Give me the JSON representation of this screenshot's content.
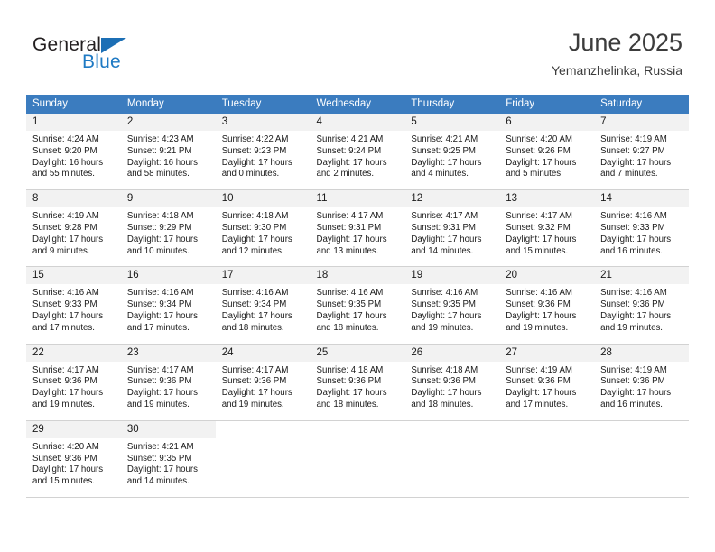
{
  "logo": {
    "word_one": "General",
    "word_two": "Blue",
    "triangle": "blue-triangle",
    "accent_color": "#1c6fb5",
    "text_color": "#231f20"
  },
  "header": {
    "title": "June 2025",
    "subtitle": "Yemanzhelinka, Russia"
  },
  "calendar": {
    "header_color": "#3b7cbf",
    "daynum_bg": "#f2f2f2",
    "weekdays": [
      "Sunday",
      "Monday",
      "Tuesday",
      "Wednesday",
      "Thursday",
      "Friday",
      "Saturday"
    ],
    "weeks": [
      [
        {
          "day": "1",
          "sunrise": "Sunrise: 4:24 AM",
          "sunset": "Sunset: 9:20 PM",
          "daylight_1": "Daylight: 16 hours",
          "daylight_2": "and 55 minutes."
        },
        {
          "day": "2",
          "sunrise": "Sunrise: 4:23 AM",
          "sunset": "Sunset: 9:21 PM",
          "daylight_1": "Daylight: 16 hours",
          "daylight_2": "and 58 minutes."
        },
        {
          "day": "3",
          "sunrise": "Sunrise: 4:22 AM",
          "sunset": "Sunset: 9:23 PM",
          "daylight_1": "Daylight: 17 hours",
          "daylight_2": "and 0 minutes."
        },
        {
          "day": "4",
          "sunrise": "Sunrise: 4:21 AM",
          "sunset": "Sunset: 9:24 PM",
          "daylight_1": "Daylight: 17 hours",
          "daylight_2": "and 2 minutes."
        },
        {
          "day": "5",
          "sunrise": "Sunrise: 4:21 AM",
          "sunset": "Sunset: 9:25 PM",
          "daylight_1": "Daylight: 17 hours",
          "daylight_2": "and 4 minutes."
        },
        {
          "day": "6",
          "sunrise": "Sunrise: 4:20 AM",
          "sunset": "Sunset: 9:26 PM",
          "daylight_1": "Daylight: 17 hours",
          "daylight_2": "and 5 minutes."
        },
        {
          "day": "7",
          "sunrise": "Sunrise: 4:19 AM",
          "sunset": "Sunset: 9:27 PM",
          "daylight_1": "Daylight: 17 hours",
          "daylight_2": "and 7 minutes."
        }
      ],
      [
        {
          "day": "8",
          "sunrise": "Sunrise: 4:19 AM",
          "sunset": "Sunset: 9:28 PM",
          "daylight_1": "Daylight: 17 hours",
          "daylight_2": "and 9 minutes."
        },
        {
          "day": "9",
          "sunrise": "Sunrise: 4:18 AM",
          "sunset": "Sunset: 9:29 PM",
          "daylight_1": "Daylight: 17 hours",
          "daylight_2": "and 10 minutes."
        },
        {
          "day": "10",
          "sunrise": "Sunrise: 4:18 AM",
          "sunset": "Sunset: 9:30 PM",
          "daylight_1": "Daylight: 17 hours",
          "daylight_2": "and 12 minutes."
        },
        {
          "day": "11",
          "sunrise": "Sunrise: 4:17 AM",
          "sunset": "Sunset: 9:31 PM",
          "daylight_1": "Daylight: 17 hours",
          "daylight_2": "and 13 minutes."
        },
        {
          "day": "12",
          "sunrise": "Sunrise: 4:17 AM",
          "sunset": "Sunset: 9:31 PM",
          "daylight_1": "Daylight: 17 hours",
          "daylight_2": "and 14 minutes."
        },
        {
          "day": "13",
          "sunrise": "Sunrise: 4:17 AM",
          "sunset": "Sunset: 9:32 PM",
          "daylight_1": "Daylight: 17 hours",
          "daylight_2": "and 15 minutes."
        },
        {
          "day": "14",
          "sunrise": "Sunrise: 4:16 AM",
          "sunset": "Sunset: 9:33 PM",
          "daylight_1": "Daylight: 17 hours",
          "daylight_2": "and 16 minutes."
        }
      ],
      [
        {
          "day": "15",
          "sunrise": "Sunrise: 4:16 AM",
          "sunset": "Sunset: 9:33 PM",
          "daylight_1": "Daylight: 17 hours",
          "daylight_2": "and 17 minutes."
        },
        {
          "day": "16",
          "sunrise": "Sunrise: 4:16 AM",
          "sunset": "Sunset: 9:34 PM",
          "daylight_1": "Daylight: 17 hours",
          "daylight_2": "and 17 minutes."
        },
        {
          "day": "17",
          "sunrise": "Sunrise: 4:16 AM",
          "sunset": "Sunset: 9:34 PM",
          "daylight_1": "Daylight: 17 hours",
          "daylight_2": "and 18 minutes."
        },
        {
          "day": "18",
          "sunrise": "Sunrise: 4:16 AM",
          "sunset": "Sunset: 9:35 PM",
          "daylight_1": "Daylight: 17 hours",
          "daylight_2": "and 18 minutes."
        },
        {
          "day": "19",
          "sunrise": "Sunrise: 4:16 AM",
          "sunset": "Sunset: 9:35 PM",
          "daylight_1": "Daylight: 17 hours",
          "daylight_2": "and 19 minutes."
        },
        {
          "day": "20",
          "sunrise": "Sunrise: 4:16 AM",
          "sunset": "Sunset: 9:36 PM",
          "daylight_1": "Daylight: 17 hours",
          "daylight_2": "and 19 minutes."
        },
        {
          "day": "21",
          "sunrise": "Sunrise: 4:16 AM",
          "sunset": "Sunset: 9:36 PM",
          "daylight_1": "Daylight: 17 hours",
          "daylight_2": "and 19 minutes."
        }
      ],
      [
        {
          "day": "22",
          "sunrise": "Sunrise: 4:17 AM",
          "sunset": "Sunset: 9:36 PM",
          "daylight_1": "Daylight: 17 hours",
          "daylight_2": "and 19 minutes."
        },
        {
          "day": "23",
          "sunrise": "Sunrise: 4:17 AM",
          "sunset": "Sunset: 9:36 PM",
          "daylight_1": "Daylight: 17 hours",
          "daylight_2": "and 19 minutes."
        },
        {
          "day": "24",
          "sunrise": "Sunrise: 4:17 AM",
          "sunset": "Sunset: 9:36 PM",
          "daylight_1": "Daylight: 17 hours",
          "daylight_2": "and 19 minutes."
        },
        {
          "day": "25",
          "sunrise": "Sunrise: 4:18 AM",
          "sunset": "Sunset: 9:36 PM",
          "daylight_1": "Daylight: 17 hours",
          "daylight_2": "and 18 minutes."
        },
        {
          "day": "26",
          "sunrise": "Sunrise: 4:18 AM",
          "sunset": "Sunset: 9:36 PM",
          "daylight_1": "Daylight: 17 hours",
          "daylight_2": "and 18 minutes."
        },
        {
          "day": "27",
          "sunrise": "Sunrise: 4:19 AM",
          "sunset": "Sunset: 9:36 PM",
          "daylight_1": "Daylight: 17 hours",
          "daylight_2": "and 17 minutes."
        },
        {
          "day": "28",
          "sunrise": "Sunrise: 4:19 AM",
          "sunset": "Sunset: 9:36 PM",
          "daylight_1": "Daylight: 17 hours",
          "daylight_2": "and 16 minutes."
        }
      ],
      [
        {
          "day": "29",
          "sunrise": "Sunrise: 4:20 AM",
          "sunset": "Sunset: 9:36 PM",
          "daylight_1": "Daylight: 17 hours",
          "daylight_2": "and 15 minutes."
        },
        {
          "day": "30",
          "sunrise": "Sunrise: 4:21 AM",
          "sunset": "Sunset: 9:35 PM",
          "daylight_1": "Daylight: 17 hours",
          "daylight_2": "and 14 minutes."
        },
        null,
        null,
        null,
        null,
        null
      ]
    ]
  }
}
